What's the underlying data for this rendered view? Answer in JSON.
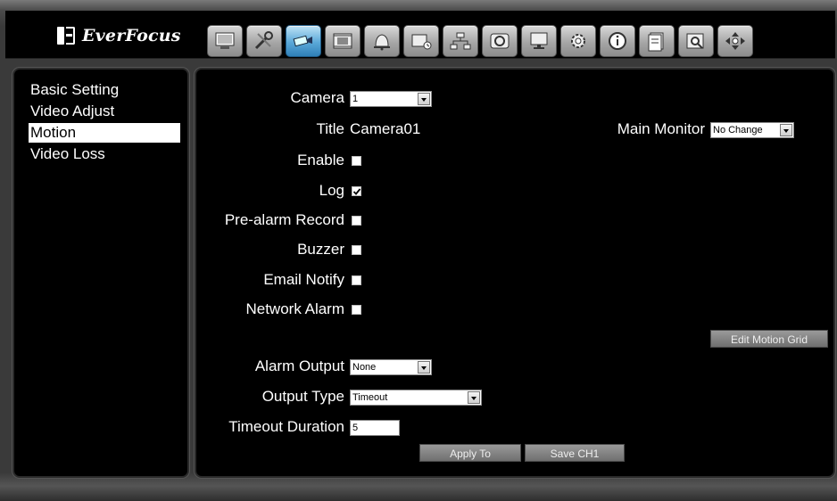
{
  "brand": {
    "name": "EverFocus"
  },
  "toolbar": {
    "icons": [
      "monitor-icon",
      "tools-icon",
      "camera-icon",
      "film-icon",
      "alarm-bell-icon",
      "record-schedule-icon",
      "network-icon",
      "disk-icon",
      "display-icon",
      "gear-icon",
      "info-icon",
      "log-icon",
      "search-icon",
      "ptz-icon"
    ],
    "active_index": 2
  },
  "sidebar": {
    "items": [
      {
        "label": "Basic Setting"
      },
      {
        "label": "Video Adjust"
      },
      {
        "label": "Motion"
      },
      {
        "label": "Video Loss"
      }
    ],
    "active": "Motion"
  },
  "form": {
    "camera": {
      "label": "Camera",
      "value": "1"
    },
    "title": {
      "label": "Title",
      "value": "Camera01"
    },
    "main_monitor": {
      "label": "Main Monitor",
      "value": "No Change"
    },
    "enable": {
      "label": "Enable",
      "checked": false
    },
    "log": {
      "label": "Log",
      "checked": true
    },
    "pre_alarm_record": {
      "label": "Pre-alarm Record",
      "checked": false
    },
    "buzzer": {
      "label": "Buzzer",
      "checked": false
    },
    "email_notify": {
      "label": "Email Notify",
      "checked": false
    },
    "network_alarm": {
      "label": "Network Alarm",
      "checked": false
    },
    "alarm_output": {
      "label": "Alarm Output",
      "value": "None"
    },
    "output_type": {
      "label": "Output Type",
      "value": "Timeout"
    },
    "timeout_duration": {
      "label": "Timeout Duration",
      "value": "5"
    }
  },
  "buttons": {
    "edit_motion_grid": "Edit Motion Grid",
    "apply_to": "Apply To",
    "save": "Save CH1"
  }
}
